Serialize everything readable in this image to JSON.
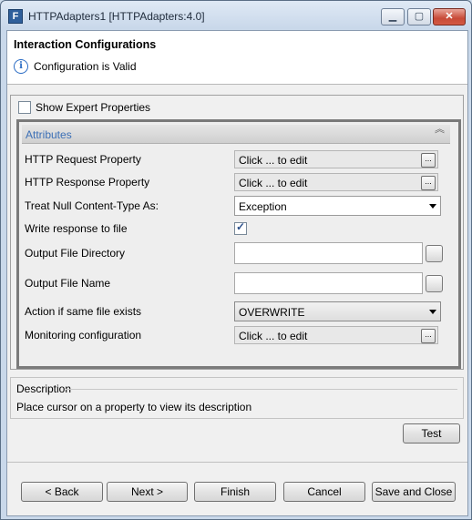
{
  "window": {
    "title": "HTTPAdapters1 [HTTPAdapters:4.0]",
    "app_icon_letter": "F",
    "min_glyph": "▁",
    "max_glyph": "▢",
    "close_glyph": "✕"
  },
  "header": {
    "title": "Interaction Configurations",
    "status_icon": "i",
    "status": "Configuration is Valid"
  },
  "expert": {
    "label": "Show Expert Properties",
    "checked": false
  },
  "attributes": {
    "title": "Attributes",
    "collapse_glyph": "︽",
    "rows": {
      "http_request": {
        "label": "HTTP Request Property",
        "value": "Click ... to edit",
        "button": "..."
      },
      "http_response": {
        "label": "HTTP Response Property",
        "value": "Click ... to edit",
        "button": "..."
      },
      "null_content_type": {
        "label": "Treat Null Content-Type As:",
        "value": "Exception"
      },
      "write_response": {
        "label": "Write response to file",
        "checked": true
      },
      "output_dir": {
        "label": "Output File Directory",
        "value": ""
      },
      "output_name": {
        "label": "Output File Name",
        "value": ""
      },
      "same_file": {
        "label": "Action if same file exists",
        "value": "OVERWRITE"
      },
      "monitoring": {
        "label": "Monitoring configuration",
        "value": "Click ... to edit",
        "button": "..."
      }
    }
  },
  "description": {
    "title": "Description",
    "text": "Place cursor on a property to view its description"
  },
  "buttons": {
    "test": "Test",
    "back": "< Back",
    "next": "Next >",
    "finish": "Finish",
    "cancel": "Cancel",
    "save_close": "Save and Close"
  }
}
